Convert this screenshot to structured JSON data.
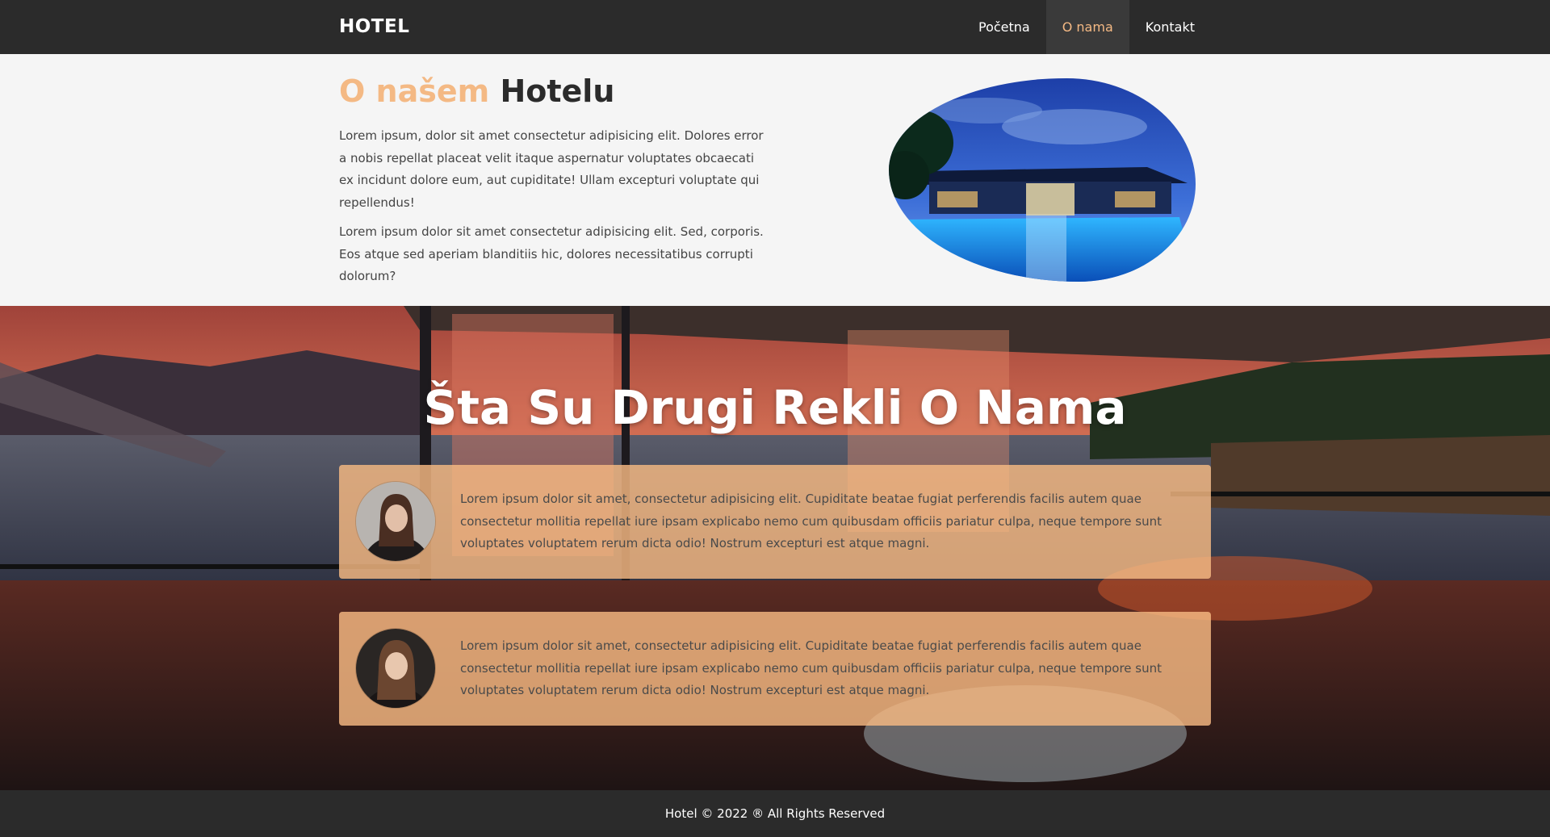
{
  "nav": {
    "brand": "HOTEL",
    "links": [
      {
        "label": "Početna",
        "active": false
      },
      {
        "label": "O nama",
        "active": true
      },
      {
        "label": "Kontakt",
        "active": false
      }
    ]
  },
  "about": {
    "title_accent": "O našem",
    "title_rest": "Hotelu",
    "paragraphs": [
      "Lorem ipsum, dolor sit amet consectetur adipisicing elit. Dolores error a nobis repellat placeat velit itaque aspernatur voluptates obcaecati ex incidunt dolore eum, aut cupiditate! Ullam excepturi voluptate qui repellendus!",
      "Lorem ipsum dolor sit amet consectetur adipisicing elit. Sed, corporis. Eos atque sed aperiam blanditiis hic, dolores necessitatibus corrupti dolorum?"
    ]
  },
  "testimonials": {
    "title": "Šta Su Drugi Rekli O Nama",
    "items": [
      {
        "text": "Lorem ipsum dolor sit amet, consectetur adipisicing elit. Cupiditate beatae fugiat perferendis facilis autem quae consectetur mollitia repellat iure ipsam explicabo nemo cum quibusdam officiis pariatur culpa, neque tempore sunt voluptates voluptatem rerum dicta odio! Nostrum excepturi est atque magni."
      },
      {
        "text": "Lorem ipsum dolor sit amet, consectetur adipisicing elit. Cupiditate beatae fugiat perferendis facilis autem quae consectetur mollitia repellat iure ipsam explicabo nemo cum quibusdam officiis pariatur culpa, neque tempore sunt voluptates voluptatem rerum dicta odio! Nostrum excepturi est atque magni."
      }
    ]
  },
  "footer": {
    "text": "Hotel © 2022 ® All Rights Reserved"
  },
  "colors": {
    "nav_bg": "#2b2b2b",
    "accent": "#f4b984",
    "card_bg": "#f7ba82",
    "page_bg": "#f5f5f5"
  }
}
